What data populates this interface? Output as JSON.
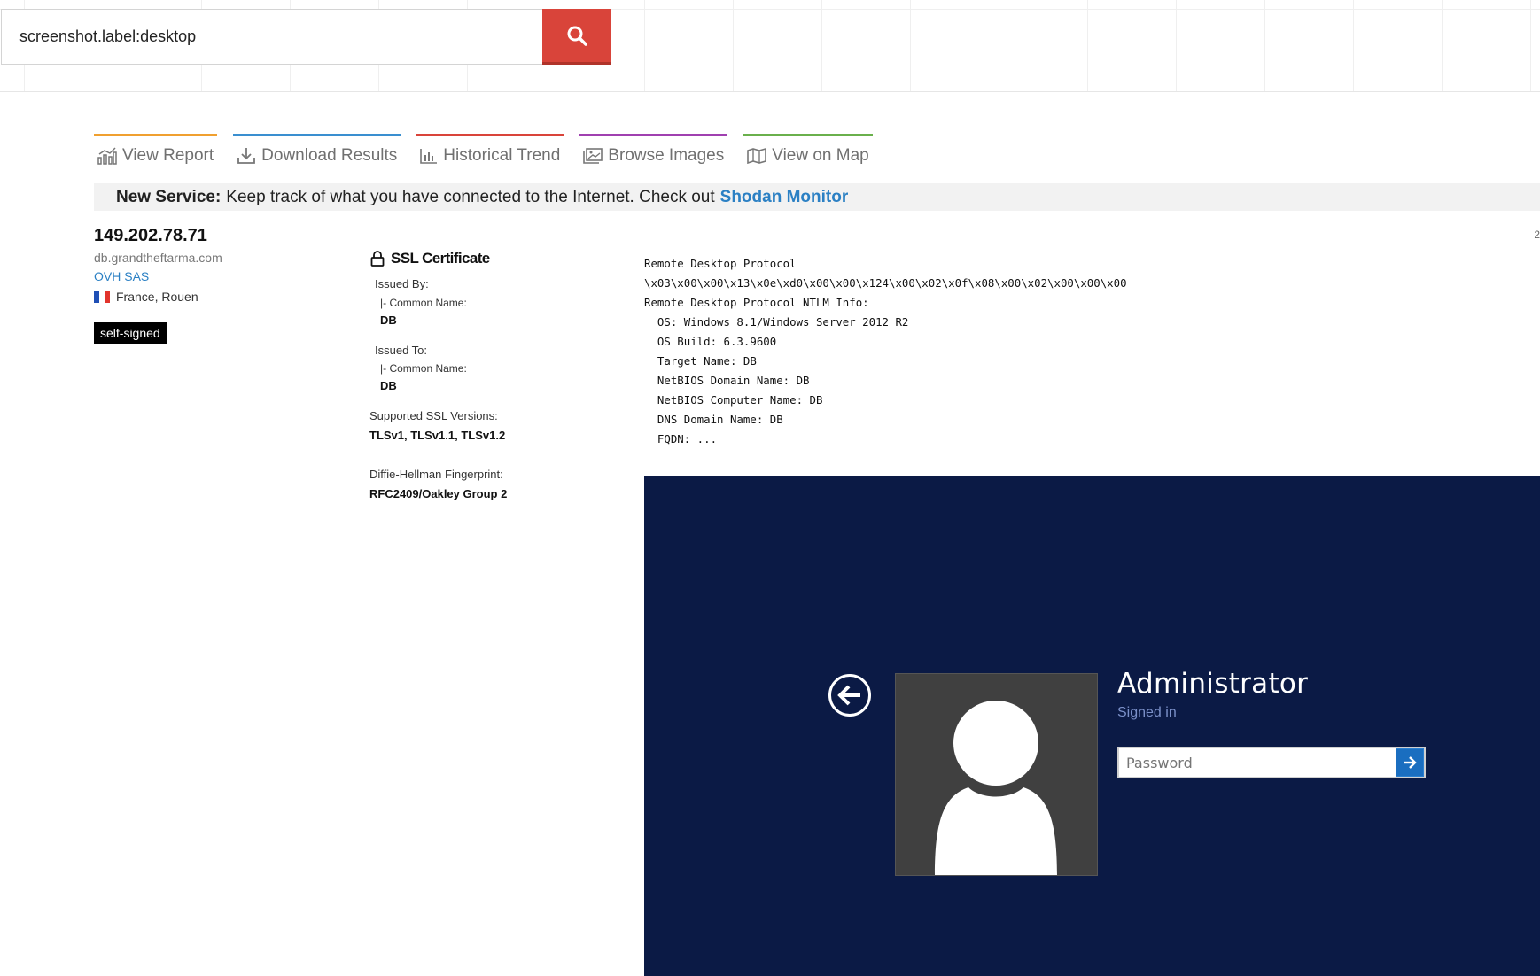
{
  "search": {
    "value": "screenshot.label:desktop",
    "button_icon": "search-icon"
  },
  "tabs": [
    {
      "label": "View Report",
      "icon": "chart-icon",
      "color": "#f0a030"
    },
    {
      "label": "Download Results",
      "icon": "download-icon",
      "color": "#3a8fd0"
    },
    {
      "label": "Historical Trend",
      "icon": "bar-chart-icon",
      "color": "#d9443a"
    },
    {
      "label": "Browse Images",
      "icon": "images-icon",
      "color": "#a040b0"
    },
    {
      "label": "View on Map",
      "icon": "map-icon",
      "color": "#6ab04c"
    }
  ],
  "banner": {
    "bold": "New Service:",
    "text": "Keep track of what you have connected to the Internet. Check out",
    "link": "Shodan Monitor"
  },
  "host": {
    "ip": "149.202.78.71",
    "hostname": "db.grandtheftarma.com",
    "org": "OVH SAS",
    "location": "France, Rouen",
    "tag": "self-signed"
  },
  "ssl": {
    "title": "SSL Certificate",
    "issued_by_label": "Issued By:",
    "issued_by_sub": "|- Common Name:",
    "issued_by_value": "DB",
    "issued_to_label": "Issued To:",
    "issued_to_sub": "|- Common Name:",
    "issued_to_value": "DB",
    "versions_label": "Supported SSL Versions:",
    "versions_value": "TLSv1, TLSv1.1, TLSv1.2",
    "dh_label": "Diffie-Hellman Fingerprint:",
    "dh_value": "RFC2409/Oakley Group 2"
  },
  "service_banner": {
    "lines": [
      "Remote Desktop Protocol",
      "\\x03\\x00\\x00\\x13\\x0e\\xd0\\x00\\x00\\x124\\x00\\x02\\x0f\\x08\\x00\\x02\\x00\\x00\\x00",
      "Remote Desktop Protocol NTLM Info:",
      "  OS: Windows 8.1/Windows Server 2012 R2",
      "  OS Build: 6.3.9600",
      "  Target Name: DB",
      "  NetBIOS Domain Name: DB",
      "  NetBIOS Computer Name: DB",
      "  DNS Domain Name: DB",
      "  FQDN: ..."
    ]
  },
  "rdp_screen": {
    "username": "Administrator",
    "status": "Signed in",
    "password_placeholder": "Password",
    "background_color": "#0b1a45"
  },
  "edge_mark": "2"
}
